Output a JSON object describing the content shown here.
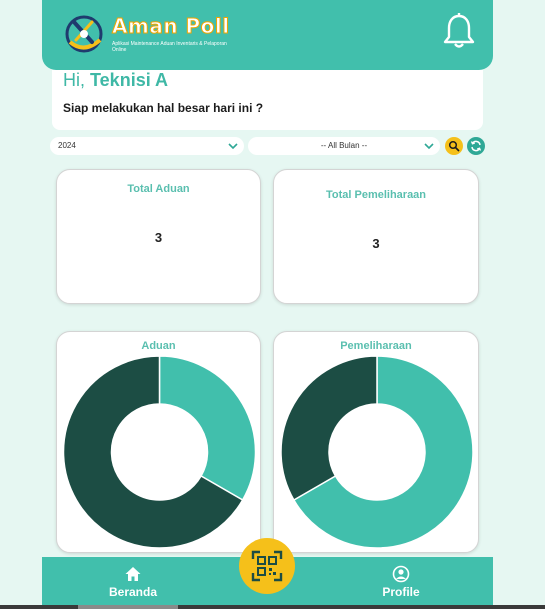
{
  "header": {
    "logo_title": "Aman Poll",
    "logo_subtitle": "Aplikasi Maintenance Aduan Inventaris & Pelaporan Online",
    "icons": {
      "logo": "logo-icon",
      "notification": "bell-icon"
    }
  },
  "greeting": {
    "hi": "Hi,",
    "name": "Teknisi A",
    "subtitle": "Siap melakukan hal besar hari ini ?"
  },
  "filters": {
    "year": "2024",
    "month": "-- All Bulan --",
    "search_icon": "search-icon",
    "refresh_icon": "refresh-icon"
  },
  "stats": {
    "aduan": {
      "title": "Total Aduan",
      "value": "3"
    },
    "pemeliharaan": {
      "title": "Total Pemeliharaan",
      "value": "3"
    }
  },
  "chart_data": [
    {
      "type": "pie",
      "title": "Aduan",
      "values": [
        1,
        2
      ],
      "colors": [
        "#41bfac",
        "#1c4d44"
      ]
    },
    {
      "type": "pie",
      "title": "Pemeliharaan",
      "values": [
        2,
        1
      ],
      "colors": [
        "#41bfac",
        "#1c4d44"
      ]
    }
  ],
  "nav": {
    "home": {
      "label": "Beranda",
      "icon": "home-icon"
    },
    "profile": {
      "label": "Profile",
      "icon": "user-icon"
    },
    "scan": {
      "icon": "qr-scan-icon"
    }
  },
  "colors": {
    "primary": "#41bfac",
    "dark": "#1c4d44",
    "accent": "#f5c01a",
    "background": "#e6f7f2"
  }
}
